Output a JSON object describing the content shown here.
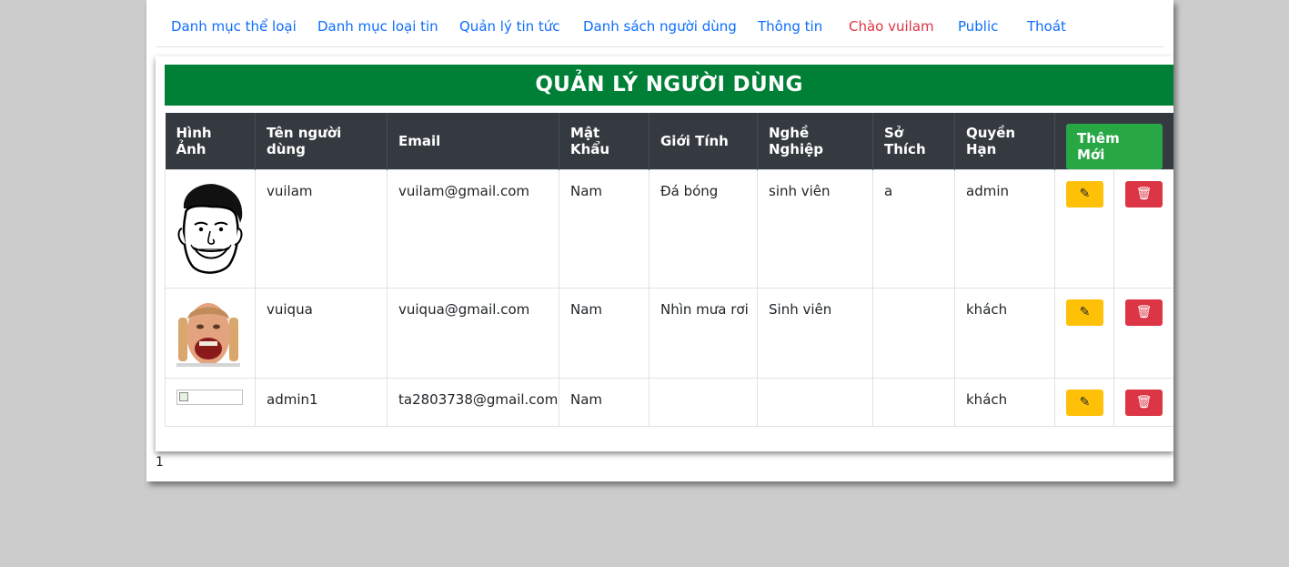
{
  "nav": {
    "items": [
      {
        "label": "Danh mục thể loại"
      },
      {
        "label": "Danh mục loại tin"
      },
      {
        "label": "Quản lý tin tức"
      },
      {
        "label": "Danh sách người dùng"
      },
      {
        "label": "Thông tin"
      },
      {
        "label": "Chào vuilam"
      },
      {
        "label": "Public"
      },
      {
        "label": "Thoát"
      }
    ]
  },
  "banner": {
    "title": "QUẢN LÝ NGƯỜI DÙNG"
  },
  "table": {
    "headers": [
      "Hình Ảnh",
      "Tên người dùng",
      "Email",
      "Mật Khẩu",
      "Giới Tính",
      "Nghề Nghiệp",
      "Sở Thích",
      "Quyền Hạn"
    ],
    "add_button": "Thêm Mới",
    "rows": [
      {
        "username": "vuilam",
        "email": "vuilam@gmail.com",
        "password": "Nam",
        "gender": "Đá bóng",
        "job": "sinh viên",
        "hobby": "a",
        "role": "admin",
        "avatar": "cartoon-face"
      },
      {
        "username": "vuiqua",
        "email": "vuiqua@gmail.com",
        "password": "Nam",
        "gender": "Nhìn mưa rơi",
        "job": "Sinh viên",
        "hobby": "",
        "role": "khách",
        "avatar": "photo-face"
      },
      {
        "username": "admin1",
        "email": "ta2803738@gmail.com",
        "password": "Nam",
        "gender": "",
        "job": "",
        "hobby": "",
        "role": "khách",
        "avatar": "broken-image"
      }
    ]
  },
  "footer": {
    "text": "1"
  },
  "icons": {
    "edit": "pencil-icon",
    "delete": "trash-icon"
  },
  "colors": {
    "banner": "#008037",
    "header": "#343a40",
    "add": "#28a745",
    "edit": "#ffc107",
    "delete": "#dc3545",
    "link": "#0d6efd",
    "greeting": "#dc3545"
  }
}
